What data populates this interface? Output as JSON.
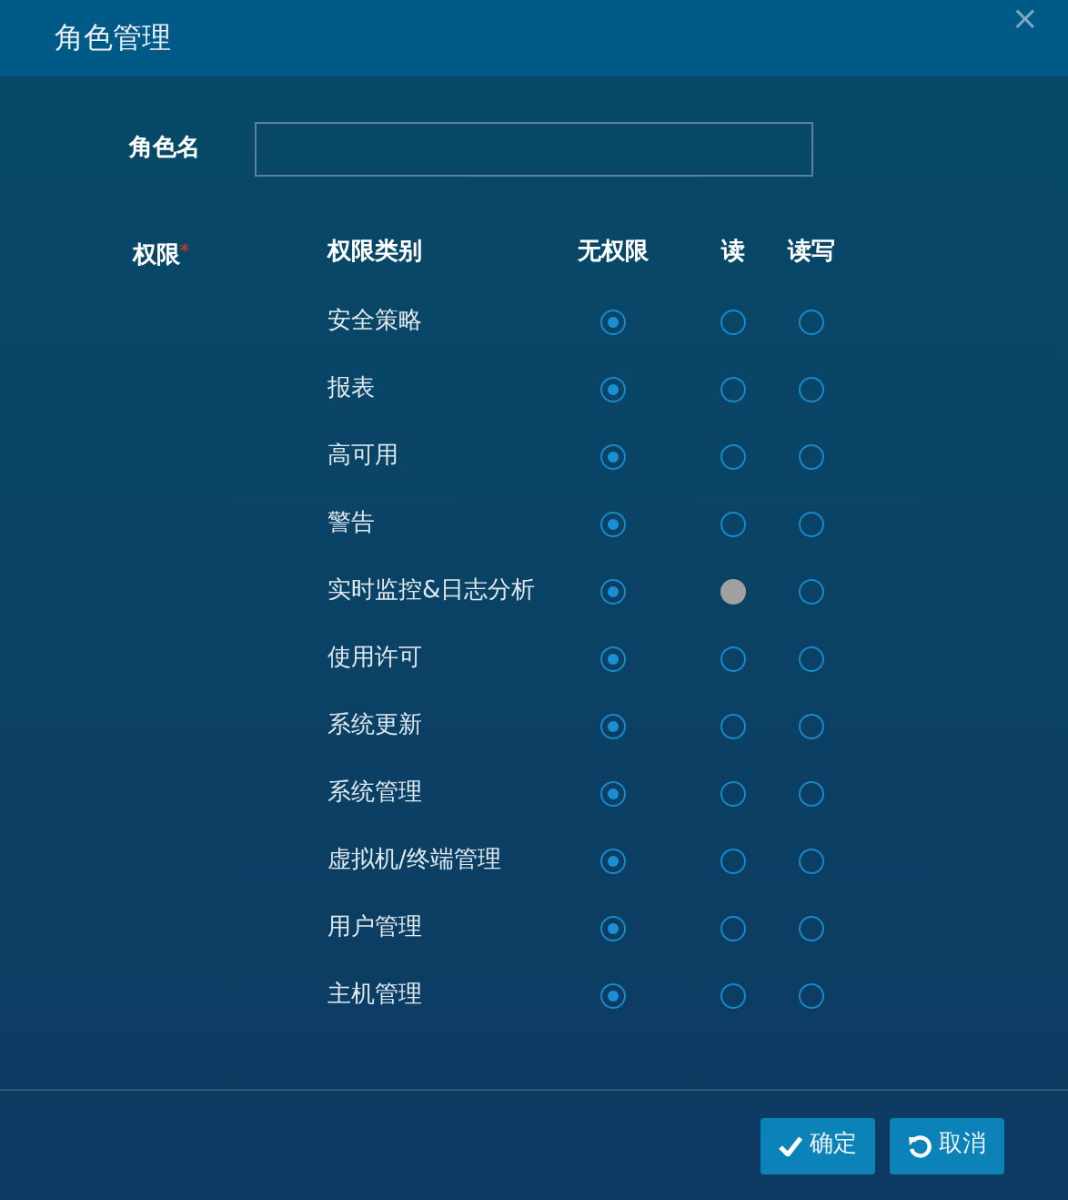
{
  "dialog": {
    "title": "角色管理",
    "close": "×"
  },
  "role_name": {
    "label": "角色名"
  },
  "permissions": {
    "label": "权限",
    "required_mark": "*",
    "columns": [
      "权限类别",
      "无权限",
      "读",
      "读写"
    ],
    "rows": [
      {
        "name": "安全策略",
        "options": [
          {
            "selected": true,
            "hovered": false
          },
          {
            "selected": false,
            "hovered": false
          },
          {
            "selected": false,
            "hovered": false
          }
        ]
      },
      {
        "name": "报表",
        "options": [
          {
            "selected": true,
            "hovered": false
          },
          {
            "selected": false,
            "hovered": false
          },
          {
            "selected": false,
            "hovered": false
          }
        ]
      },
      {
        "name": "高可用",
        "options": [
          {
            "selected": true,
            "hovered": false
          },
          {
            "selected": false,
            "hovered": false
          },
          {
            "selected": false,
            "hovered": false
          }
        ]
      },
      {
        "name": "警告",
        "options": [
          {
            "selected": true,
            "hovered": false
          },
          {
            "selected": false,
            "hovered": false
          },
          {
            "selected": false,
            "hovered": false
          }
        ]
      },
      {
        "name": "实时监控&日志分析",
        "options": [
          {
            "selected": true,
            "hovered": false
          },
          {
            "selected": false,
            "hovered": true
          },
          {
            "selected": false,
            "hovered": false
          }
        ]
      },
      {
        "name": "使用许可",
        "options": [
          {
            "selected": true,
            "hovered": false
          },
          {
            "selected": false,
            "hovered": false
          },
          {
            "selected": false,
            "hovered": false
          }
        ]
      },
      {
        "name": "系统更新",
        "options": [
          {
            "selected": true,
            "hovered": false
          },
          {
            "selected": false,
            "hovered": false
          },
          {
            "selected": false,
            "hovered": false
          }
        ]
      },
      {
        "name": "系统管理",
        "options": [
          {
            "selected": true,
            "hovered": false
          },
          {
            "selected": false,
            "hovered": false
          },
          {
            "selected": false,
            "hovered": false
          }
        ]
      },
      {
        "name": "虚拟机/终端管理",
        "options": [
          {
            "selected": true,
            "hovered": false
          },
          {
            "selected": false,
            "hovered": false
          },
          {
            "selected": false,
            "hovered": false
          }
        ]
      },
      {
        "name": "用户管理",
        "options": [
          {
            "selected": true,
            "hovered": false
          },
          {
            "selected": false,
            "hovered": false
          },
          {
            "selected": false,
            "hovered": false
          }
        ]
      },
      {
        "name": "主机管理",
        "options": [
          {
            "selected": true,
            "hovered": false
          },
          {
            "selected": false,
            "hovered": false
          },
          {
            "selected": false,
            "hovered": false
          }
        ]
      }
    ]
  },
  "buttons": [
    {
      "kind": "confirm",
      "label": "确定"
    },
    {
      "kind": "cancel",
      "label": "取消"
    }
  ]
}
